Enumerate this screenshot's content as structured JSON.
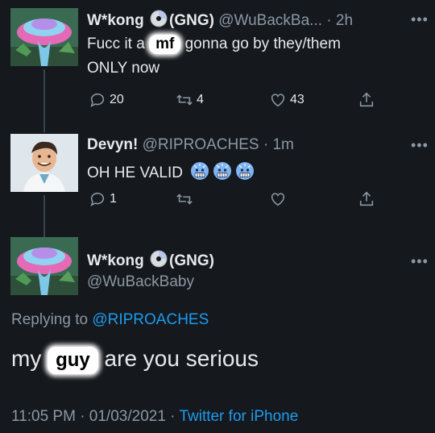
{
  "tweets": [
    {
      "display_name": "W*kong",
      "badge": "(GNG)",
      "handle": "@WuBackBa...",
      "time": "· 2h",
      "text_before": "Fucc it a ",
      "censored": "mf",
      "text_after": " gonna go by they/them",
      "text_line2": "ONLY now",
      "replies": "20",
      "retweets": "4",
      "likes": "43"
    },
    {
      "display_name": "Devyn!",
      "handle": "@RIPROACHES",
      "time": "· 1m",
      "text": "OH HE VALID",
      "emoji": "cold-face-emoji",
      "replies": "1"
    }
  ],
  "main_tweet": {
    "display_name": "W*kong",
    "badge": "(GNG)",
    "handle": "@WuBackBaby",
    "replying_prefix": "Replying to ",
    "replying_to": "@RIPROACHES",
    "text_before": "my ",
    "censored": "guy",
    "text_after": " are you serious",
    "timestamp": "11:05 PM · 01/03/2021 · ",
    "source": "Twitter for iPhone"
  },
  "more_glyph": "•••",
  "colors": {
    "background": "#15181c",
    "link": "#1d9bf0",
    "muted": "#8b98a5"
  }
}
